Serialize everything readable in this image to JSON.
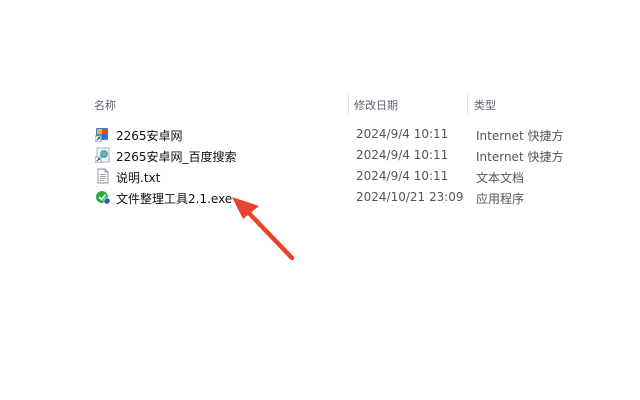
{
  "columns": {
    "name": "名称",
    "date": "修改日期",
    "type": "类型"
  },
  "files": [
    {
      "name": "2265安卓网",
      "date": "2024/9/4 10:11",
      "type": "Internet 快捷方",
      "icon": "internet-shortcut-icon"
    },
    {
      "name": "2265安卓网_百度搜索",
      "date": "2024/9/4 10:11",
      "type": "Internet 快捷方",
      "icon": "internet-shortcut-icon"
    },
    {
      "name": "说明.txt",
      "date": "2024/9/4 10:11",
      "type": "文本文档",
      "icon": "text-document-icon"
    },
    {
      "name": "文件整理工具2.1.exe",
      "date": "2024/10/21 23:09",
      "type": "应用程序",
      "icon": "application-exe-icon"
    }
  ],
  "colors": {
    "arrow": "#e8442c",
    "header_text": "#5b6370"
  }
}
